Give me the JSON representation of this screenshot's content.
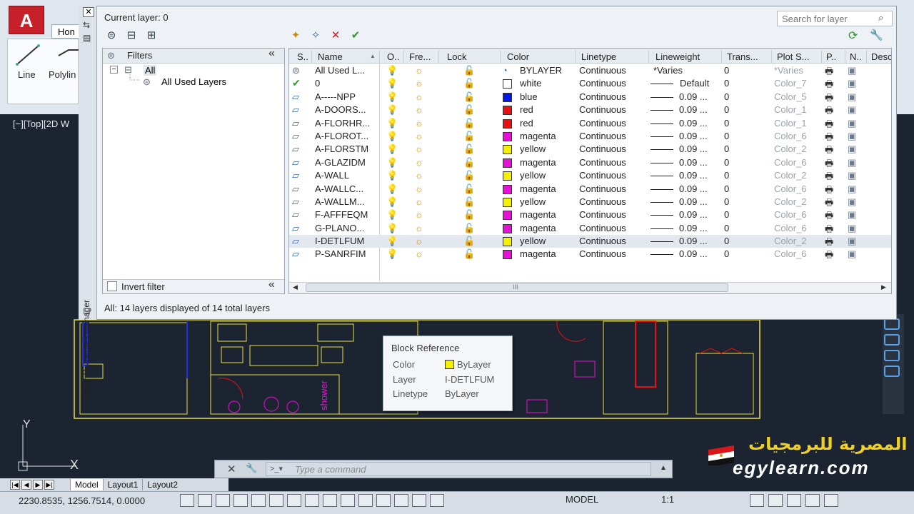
{
  "app": {
    "home_tab": "Hon",
    "tools": [
      "Line",
      "Polylin"
    ],
    "viewport_label": "[−][Top][2D W"
  },
  "palette": {
    "title": "Layer Properties Manager",
    "current_layer": "Current layer: 0",
    "search_placeholder": "Search for layer",
    "filters": {
      "header": "Filters",
      "tree": [
        "All",
        "All Used Layers"
      ],
      "invert_filter": "Invert filter"
    },
    "columns": [
      "S..",
      "Name",
      "O..",
      "Fre...",
      "Lock",
      "Color",
      "Linetype",
      "Lineweight",
      "Trans...",
      "Plot S...",
      "P..",
      "N..",
      "Desc"
    ],
    "layers": [
      {
        "name": "All Used L...",
        "color": "BYLAYER",
        "swatch": "",
        "linetype": "Continuous",
        "lineweight": "*Varies",
        "trans": "0",
        "plot_style": "*Varies",
        "kind": "filter"
      },
      {
        "name": "0",
        "color": "white",
        "swatch": "#ffffff",
        "linetype": "Continuous",
        "lineweight": "Default",
        "trans": "0",
        "plot_style": "Color_7",
        "kind": "current"
      },
      {
        "name": "A-----NPP",
        "color": "blue",
        "swatch": "#0018e8",
        "linetype": "Continuous",
        "lineweight": "0.09 ...",
        "trans": "0",
        "plot_style": "Color_5",
        "kind": "layer"
      },
      {
        "name": "A-DOORS...",
        "color": "red",
        "swatch": "#e81010",
        "linetype": "Continuous",
        "lineweight": "0.09 ...",
        "trans": "0",
        "plot_style": "Color_1",
        "kind": "layer"
      },
      {
        "name": "A-FLORHR...",
        "color": "red",
        "swatch": "#e81010",
        "linetype": "Continuous",
        "lineweight": "0.09 ...",
        "trans": "0",
        "plot_style": "Color_1",
        "kind": "layer"
      },
      {
        "name": "A-FLOROT...",
        "color": "magenta",
        "swatch": "#e810d8",
        "linetype": "Continuous",
        "lineweight": "0.09 ...",
        "trans": "0",
        "plot_style": "Color_6",
        "kind": "layer"
      },
      {
        "name": "A-FLORSTM",
        "color": "yellow",
        "swatch": "#f4f000",
        "linetype": "Continuous",
        "lineweight": "0.09 ...",
        "trans": "0",
        "plot_style": "Color_2",
        "kind": "layer"
      },
      {
        "name": "A-GLAZIDM",
        "color": "magenta",
        "swatch": "#e810d8",
        "linetype": "Continuous",
        "lineweight": "0.09 ...",
        "trans": "0",
        "plot_style": "Color_6",
        "kind": "layer"
      },
      {
        "name": "A-WALL",
        "color": "yellow",
        "swatch": "#f4f000",
        "linetype": "Continuous",
        "lineweight": "0.09 ...",
        "trans": "0",
        "plot_style": "Color_2",
        "kind": "layer"
      },
      {
        "name": "A-WALLC...",
        "color": "magenta",
        "swatch": "#e810d8",
        "linetype": "Continuous",
        "lineweight": "0.09 ...",
        "trans": "0",
        "plot_style": "Color_6",
        "kind": "layer"
      },
      {
        "name": "A-WALLM...",
        "color": "yellow",
        "swatch": "#f4f000",
        "linetype": "Continuous",
        "lineweight": "0.09 ...",
        "trans": "0",
        "plot_style": "Color_2",
        "kind": "layer"
      },
      {
        "name": "F-AFFFEQM",
        "color": "magenta",
        "swatch": "#e810d8",
        "linetype": "Continuous",
        "lineweight": "0.09 ...",
        "trans": "0",
        "plot_style": "Color_6",
        "kind": "layer"
      },
      {
        "name": "G-PLANO...",
        "color": "magenta",
        "swatch": "#e810d8",
        "linetype": "Continuous",
        "lineweight": "0.09 ...",
        "trans": "0",
        "plot_style": "Color_6",
        "kind": "layer"
      },
      {
        "name": "I-DETLFUM",
        "color": "yellow",
        "swatch": "#f4f000",
        "linetype": "Continuous",
        "lineweight": "0.09 ...",
        "trans": "0",
        "plot_style": "Color_2",
        "kind": "layer",
        "selected": true
      },
      {
        "name": "P-SANRFIM",
        "color": "magenta",
        "swatch": "#e810d8",
        "linetype": "Continuous",
        "lineweight": "0.09 ...",
        "trans": "0",
        "plot_style": "Color_6",
        "kind": "layer"
      }
    ],
    "status": "All: 14 layers displayed of 14 total layers"
  },
  "tooltip": {
    "title": "Block Reference",
    "rows": [
      {
        "key": "Color",
        "value": "ByLayer",
        "swatch": "#f4f000"
      },
      {
        "key": "Layer",
        "value": "I-DETLFUM"
      },
      {
        "key": "Linetype",
        "value": "ByLayer"
      }
    ]
  },
  "command": {
    "placeholder": "Type a command"
  },
  "layout_tabs": [
    "Model",
    "Layout1",
    "Layout2"
  ],
  "status_bar": {
    "coords": "2230.8535, 1256.7514, 0.0000",
    "model": "MODEL",
    "scale": "1:1"
  },
  "watermark": {
    "arabic": "المصرية للبرمجيات",
    "english": "egylearn.com"
  }
}
